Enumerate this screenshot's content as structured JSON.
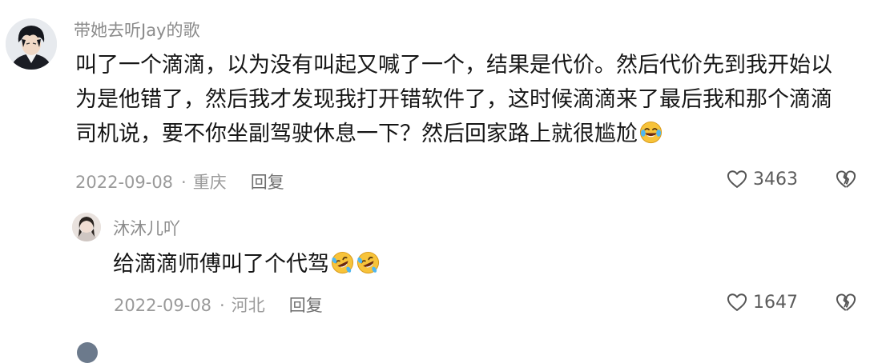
{
  "comments": [
    {
      "username": "带她去听Jay的歌",
      "lines": [
        "叫了一个滴滴，以为没有叫起又喊了一个，结果是代价。然后代价先到我开始以",
        "为是他错了，然后我才发现我打开错软件了，这时候滴滴来了最后我和那个滴滴",
        "司机说，要不你坐副驾驶休息一下？然后回家路上就很尴尬"
      ],
      "emoji": "crying-laughing-face-icon",
      "date": "2022-09-08",
      "separator": "·",
      "location": "重庆",
      "reply_label": "回复",
      "likes": "3463"
    },
    {
      "username": "沐沐儿吖",
      "text": "给滴滴师傅叫了个代驾",
      "emoji": "rolling-laughing-face-icon",
      "date": "2022-09-08",
      "separator": "·",
      "location": "河北",
      "reply_label": "回复",
      "likes": "1647"
    }
  ],
  "colors": {
    "text": "#161616",
    "meta": "#9a9a9a",
    "username": "#8b8b8b",
    "emoji": "#f5b82e"
  }
}
